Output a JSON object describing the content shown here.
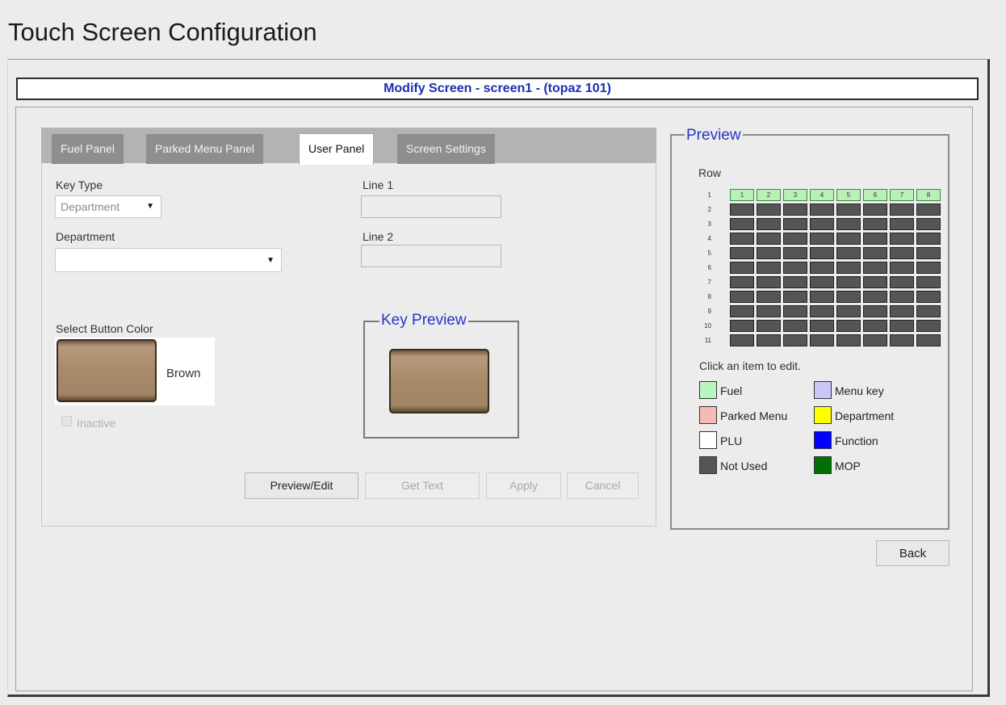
{
  "page_title": "Touch Screen Configuration",
  "header": "Modify Screen - screen1 - (topaz 101)",
  "tabs": [
    {
      "label": "Fuel Panel",
      "active": false
    },
    {
      "label": "Parked Menu Panel",
      "active": false
    },
    {
      "label": "User Panel",
      "active": true
    },
    {
      "label": "Screen Settings",
      "active": false
    }
  ],
  "form": {
    "key_type_label": "Key Type",
    "key_type_value": "Department",
    "department_label": "Department",
    "department_value": "",
    "line1_label": "Line 1",
    "line2_label": "Line 2",
    "select_color_label": "Select Button Color",
    "color_name": "Brown",
    "inactive_label": "Inactive",
    "key_preview_legend": "Key Preview"
  },
  "buttons": {
    "preview_edit": "Preview/Edit",
    "get_text": "Get Text",
    "apply": "Apply",
    "cancel": "Cancel",
    "back": "Back"
  },
  "preview": {
    "legend": "Preview",
    "row_label": "Row",
    "rows": [
      "1",
      "2",
      "3",
      "4",
      "5",
      "6",
      "7",
      "8",
      "9",
      "10",
      "11"
    ],
    "fuel_cells": [
      "1",
      "2",
      "3",
      "4",
      "5",
      "6",
      "7",
      "8"
    ],
    "hint": "Click an item to edit.",
    "legend_items": [
      {
        "label": "Fuel",
        "color": "#b8f5c0"
      },
      {
        "label": "Menu key",
        "color": "#c8c8f8"
      },
      {
        "label": "Parked Menu",
        "color": "#f8b8b8"
      },
      {
        "label": "Department",
        "color": "#ffff00"
      },
      {
        "label": "PLU",
        "color": "#ffffff"
      },
      {
        "label": "Function",
        "color": "#0000ff"
      },
      {
        "label": "Not Used",
        "color": "#555555"
      },
      {
        "label": "MOP",
        "color": "#007000"
      }
    ]
  }
}
